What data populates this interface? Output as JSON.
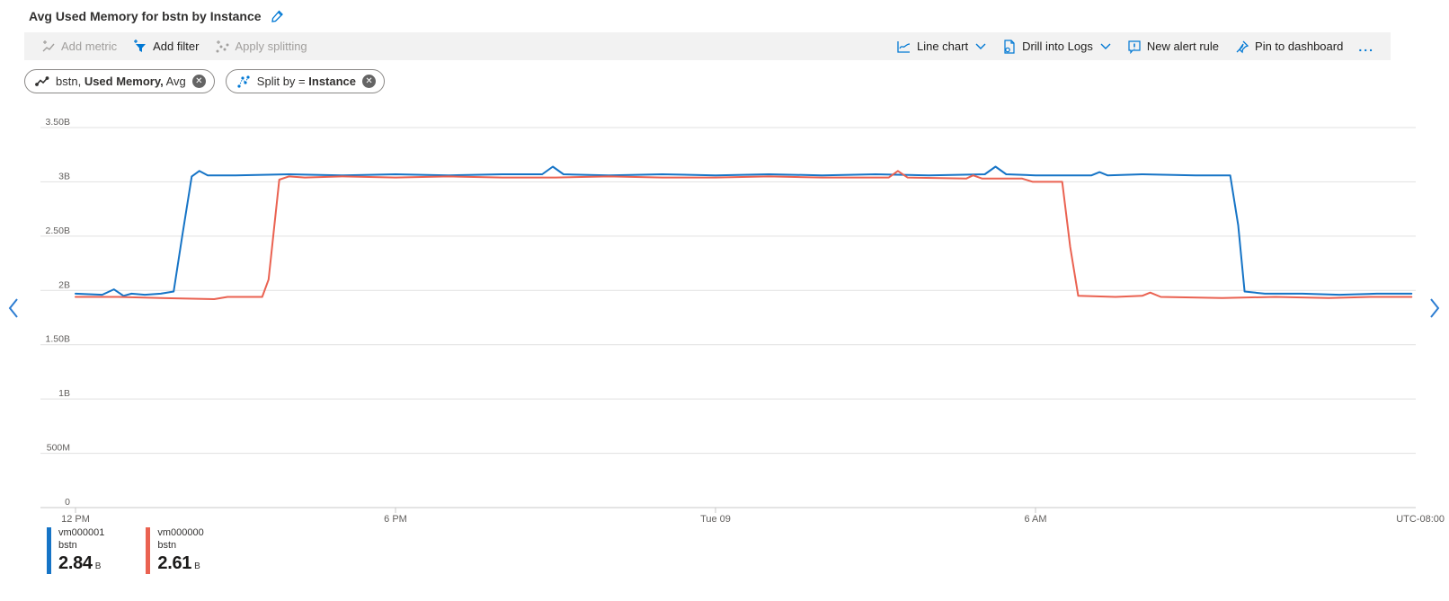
{
  "page": {
    "title": "Avg Used Memory for bstn by Instance"
  },
  "toolbar": {
    "add_metric": "Add metric",
    "add_filter": "Add filter",
    "apply_splitting": "Apply splitting",
    "line_chart": "Line chart",
    "drill_into_logs": "Drill into Logs",
    "new_alert_rule": "New alert rule",
    "pin_to_dashboard": "Pin to dashboard",
    "more_label": "..."
  },
  "pills": [
    {
      "icon": "metric-line-icon",
      "text1": "bstn,",
      "bold": "Used Memory,",
      "text2": "Avg",
      "close": "close-icon"
    },
    {
      "icon": "split-by-icon",
      "text1": "Split by =",
      "bold": "Instance",
      "text2": "",
      "close": "close-icon"
    }
  ],
  "legend": [
    {
      "name": "vm000001",
      "resource": "bstn",
      "value": "2.84",
      "unit": "B",
      "color": "#1674c6"
    },
    {
      "name": "vm000000",
      "resource": "bstn",
      "value": "2.61",
      "unit": "B",
      "color": "#ea6251"
    }
  ],
  "colors": {
    "accent_blue": "#0078d4",
    "series_blue": "#1674c6",
    "series_red": "#ea6251",
    "grid": "#e1e1e1",
    "axis": "#c8c8c8",
    "tick_text": "#605e5c",
    "disabled": "#a19f9d",
    "toolbar_bg": "#f2f2f2"
  },
  "chart_data": {
    "type": "line",
    "title": "Avg Used Memory for bstn by Instance",
    "xlabel": "",
    "ylabel": "",
    "unit": "B (billions of bytes)",
    "ylim_B": [
      0,
      3.5
    ],
    "x_range_hours_from_12PM": [
      0,
      25.05
    ],
    "grid": true,
    "legend_position": "bottom",
    "timezone_label": "UTC-08:00",
    "y_ticks": [
      {
        "label": "0",
        "value": 0
      },
      {
        "label": "500M",
        "value": 0.5
      },
      {
        "label": "1B",
        "value": 1
      },
      {
        "label": "1.50B",
        "value": 1.5
      },
      {
        "label": "2B",
        "value": 2
      },
      {
        "label": "2.50B",
        "value": 2.5
      },
      {
        "label": "3B",
        "value": 3
      },
      {
        "label": "3.50B",
        "value": 3.5
      }
    ],
    "x_ticks": [
      {
        "label": "12 PM",
        "hour": 0
      },
      {
        "label": "6 PM",
        "hour": 6
      },
      {
        "label": "Tue 09",
        "hour": 12
      },
      {
        "label": "6 AM",
        "hour": 18
      }
    ],
    "series": [
      {
        "name": "vm000001",
        "resource": "bstn",
        "avg_B": 2.84,
        "color": "#1674c6",
        "points_hour_B": [
          [
            0,
            1.97
          ],
          [
            0.5,
            1.96
          ],
          [
            0.72,
            2.01
          ],
          [
            0.9,
            1.95
          ],
          [
            1.05,
            1.97
          ],
          [
            1.3,
            1.96
          ],
          [
            1.6,
            1.97
          ],
          [
            1.84,
            1.99
          ],
          [
            2.0,
            2.5
          ],
          [
            2.18,
            3.05
          ],
          [
            2.32,
            3.1
          ],
          [
            2.48,
            3.06
          ],
          [
            3,
            3.06
          ],
          [
            4,
            3.07
          ],
          [
            5,
            3.06
          ],
          [
            6,
            3.07
          ],
          [
            7,
            3.06
          ],
          [
            8,
            3.07
          ],
          [
            8.75,
            3.07
          ],
          [
            8.95,
            3.14
          ],
          [
            9.15,
            3.07
          ],
          [
            10,
            3.06
          ],
          [
            11,
            3.07
          ],
          [
            12,
            3.06
          ],
          [
            13,
            3.07
          ],
          [
            14,
            3.06
          ],
          [
            15,
            3.07
          ],
          [
            16,
            3.06
          ],
          [
            17.05,
            3.07
          ],
          [
            17.25,
            3.14
          ],
          [
            17.45,
            3.07
          ],
          [
            18,
            3.06
          ],
          [
            19.05,
            3.06
          ],
          [
            19.2,
            3.09
          ],
          [
            19.35,
            3.06
          ],
          [
            20,
            3.07
          ],
          [
            21,
            3.06
          ],
          [
            21.65,
            3.06
          ],
          [
            21.8,
            2.6
          ],
          [
            21.92,
            1.99
          ],
          [
            22.3,
            1.97
          ],
          [
            23,
            1.97
          ],
          [
            23.7,
            1.96
          ],
          [
            24.4,
            1.97
          ],
          [
            25.05,
            1.97
          ]
        ]
      },
      {
        "name": "vm000000",
        "resource": "bstn",
        "avg_B": 2.61,
        "color": "#ea6251",
        "points_hour_B": [
          [
            0,
            1.94
          ],
          [
            0.8,
            1.94
          ],
          [
            1.6,
            1.93
          ],
          [
            2.6,
            1.92
          ],
          [
            2.85,
            1.94
          ],
          [
            3.5,
            1.94
          ],
          [
            3.62,
            2.1
          ],
          [
            3.82,
            3.02
          ],
          [
            4.0,
            3.05
          ],
          [
            4.3,
            3.04
          ],
          [
            5,
            3.05
          ],
          [
            6,
            3.04
          ],
          [
            7,
            3.05
          ],
          [
            8,
            3.04
          ],
          [
            9,
            3.04
          ],
          [
            10,
            3.05
          ],
          [
            11,
            3.04
          ],
          [
            12,
            3.04
          ],
          [
            13,
            3.05
          ],
          [
            14,
            3.04
          ],
          [
            15.25,
            3.04
          ],
          [
            15.42,
            3.1
          ],
          [
            15.6,
            3.04
          ],
          [
            16.7,
            3.03
          ],
          [
            16.83,
            3.06
          ],
          [
            17.0,
            3.03
          ],
          [
            17.75,
            3.03
          ],
          [
            17.95,
            3.0
          ],
          [
            18.5,
            3.0
          ],
          [
            18.65,
            2.4
          ],
          [
            18.8,
            1.95
          ],
          [
            19.5,
            1.94
          ],
          [
            20.0,
            1.95
          ],
          [
            20.15,
            1.98
          ],
          [
            20.35,
            1.94
          ],
          [
            21.5,
            1.93
          ],
          [
            22.5,
            1.94
          ],
          [
            23.5,
            1.93
          ],
          [
            24.3,
            1.94
          ],
          [
            25.05,
            1.94
          ]
        ]
      }
    ]
  }
}
